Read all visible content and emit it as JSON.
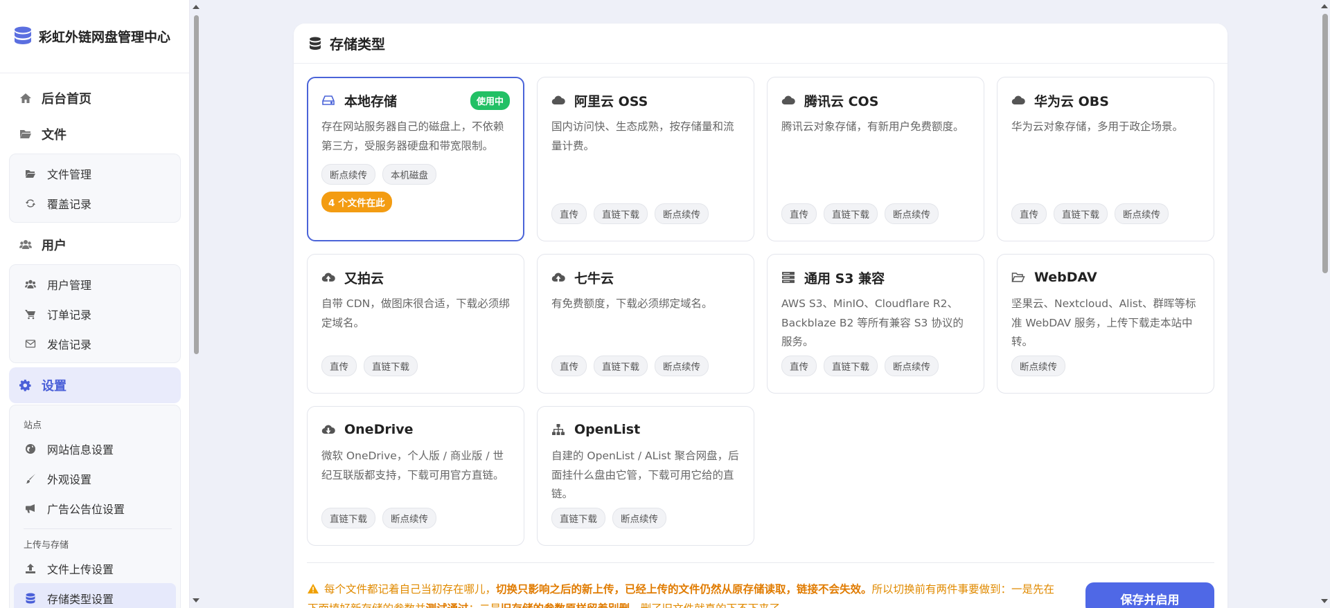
{
  "sidebar": {
    "brand": "彩虹外链网盘管理中心",
    "dashboard": "后台首页",
    "files": {
      "label": "文件",
      "items": [
        "文件管理",
        "覆盖记录"
      ]
    },
    "users": {
      "label": "用户",
      "items": [
        "用户管理",
        "订单记录",
        "发信记录"
      ]
    },
    "settings": {
      "label": "设置",
      "site_label": "站点",
      "site_items": [
        "网站信息设置",
        "外观设置",
        "广告公告位设置"
      ],
      "upload_label": "上传与存储",
      "upload_items": [
        "文件上传设置",
        "存储类型设置"
      ]
    }
  },
  "main": {
    "title": "存储类型",
    "cards": [
      {
        "name": "本地存储",
        "icon": "hard-drive-icon",
        "badge": "使用中",
        "desc": "存在网站服务器自己的磁盘上，不依赖第三方，受服务器硬盘和带宽限制。",
        "tags": [
          "断点续传",
          "本机磁盘"
        ],
        "files_here": "4 个文件在此"
      },
      {
        "name": "阿里云 OSS",
        "icon": "cloud-icon",
        "desc": "国内访问快、生态成熟，按存储量和流量计费。",
        "tags": [
          "直传",
          "直链下载",
          "断点续传"
        ]
      },
      {
        "name": "腾讯云 COS",
        "icon": "cloud-icon",
        "desc": "腾讯云对象存储，有新用户免费额度。",
        "tags": [
          "直传",
          "直链下载",
          "断点续传"
        ]
      },
      {
        "name": "华为云 OBS",
        "icon": "cloud-icon",
        "desc": "华为云对象存储，多用于政企场景。",
        "tags": [
          "直传",
          "直链下载",
          "断点续传"
        ]
      },
      {
        "name": "又拍云",
        "icon": "cloud-upload-icon",
        "desc": "自带 CDN，做图床很合适，下载必须绑定域名。",
        "tags": [
          "直传",
          "直链下载"
        ]
      },
      {
        "name": "七牛云",
        "icon": "cloud-upload-icon",
        "desc": "有免费额度，下载必须绑定域名。",
        "tags": [
          "直传",
          "直链下载",
          "断点续传"
        ]
      },
      {
        "name": "通用 S3 兼容",
        "icon": "server-icon",
        "desc": "AWS S3、MinIO、Cloudflare R2、Backblaze B2 等所有兼容 S3 协议的服务。",
        "tags": [
          "直传",
          "直链下载",
          "断点续传"
        ]
      },
      {
        "name": "WebDAV",
        "icon": "folder-open-icon",
        "desc": "坚果云、Nextcloud、Alist、群晖等标准 WebDAV 服务，上传下载走本站中转。",
        "tags": [
          "断点续传"
        ]
      },
      {
        "name": "OneDrive",
        "icon": "cloud-download-icon",
        "desc": "微软 OneDrive，个人版 / 商业版 / 世纪互联版都支持，下载可用官方直链。",
        "tags": [
          "直链下载",
          "断点续传"
        ]
      },
      {
        "name": "OpenList",
        "icon": "sitemap-icon",
        "desc": "自建的 OpenList / AList 聚合网盘，后面挂什么盘由它管，下载可用它给的直链。",
        "tags": [
          "直链下载",
          "断点续传"
        ]
      }
    ],
    "notice": {
      "part1": "每个文件都记着自己当初存在哪儿，",
      "bold1": "切换只影响之后的新上传，已经上传的文件仍然从原存储读取，链接不会失效。",
      "part2": "所以切换前有两件事要做到：一是先在下面填好新存储的参数并",
      "bold2": "测试通过",
      "part3": "；二是",
      "bold3": "旧存储的参数原样留着别删",
      "part4": "，删了旧文件就真的下不下来了。"
    },
    "save_button": "保存并启用"
  },
  "colors": {
    "accent": "#4f68e6",
    "in_use": "#22c065",
    "files_here": "#f39c12",
    "warning": "#e08a00"
  }
}
